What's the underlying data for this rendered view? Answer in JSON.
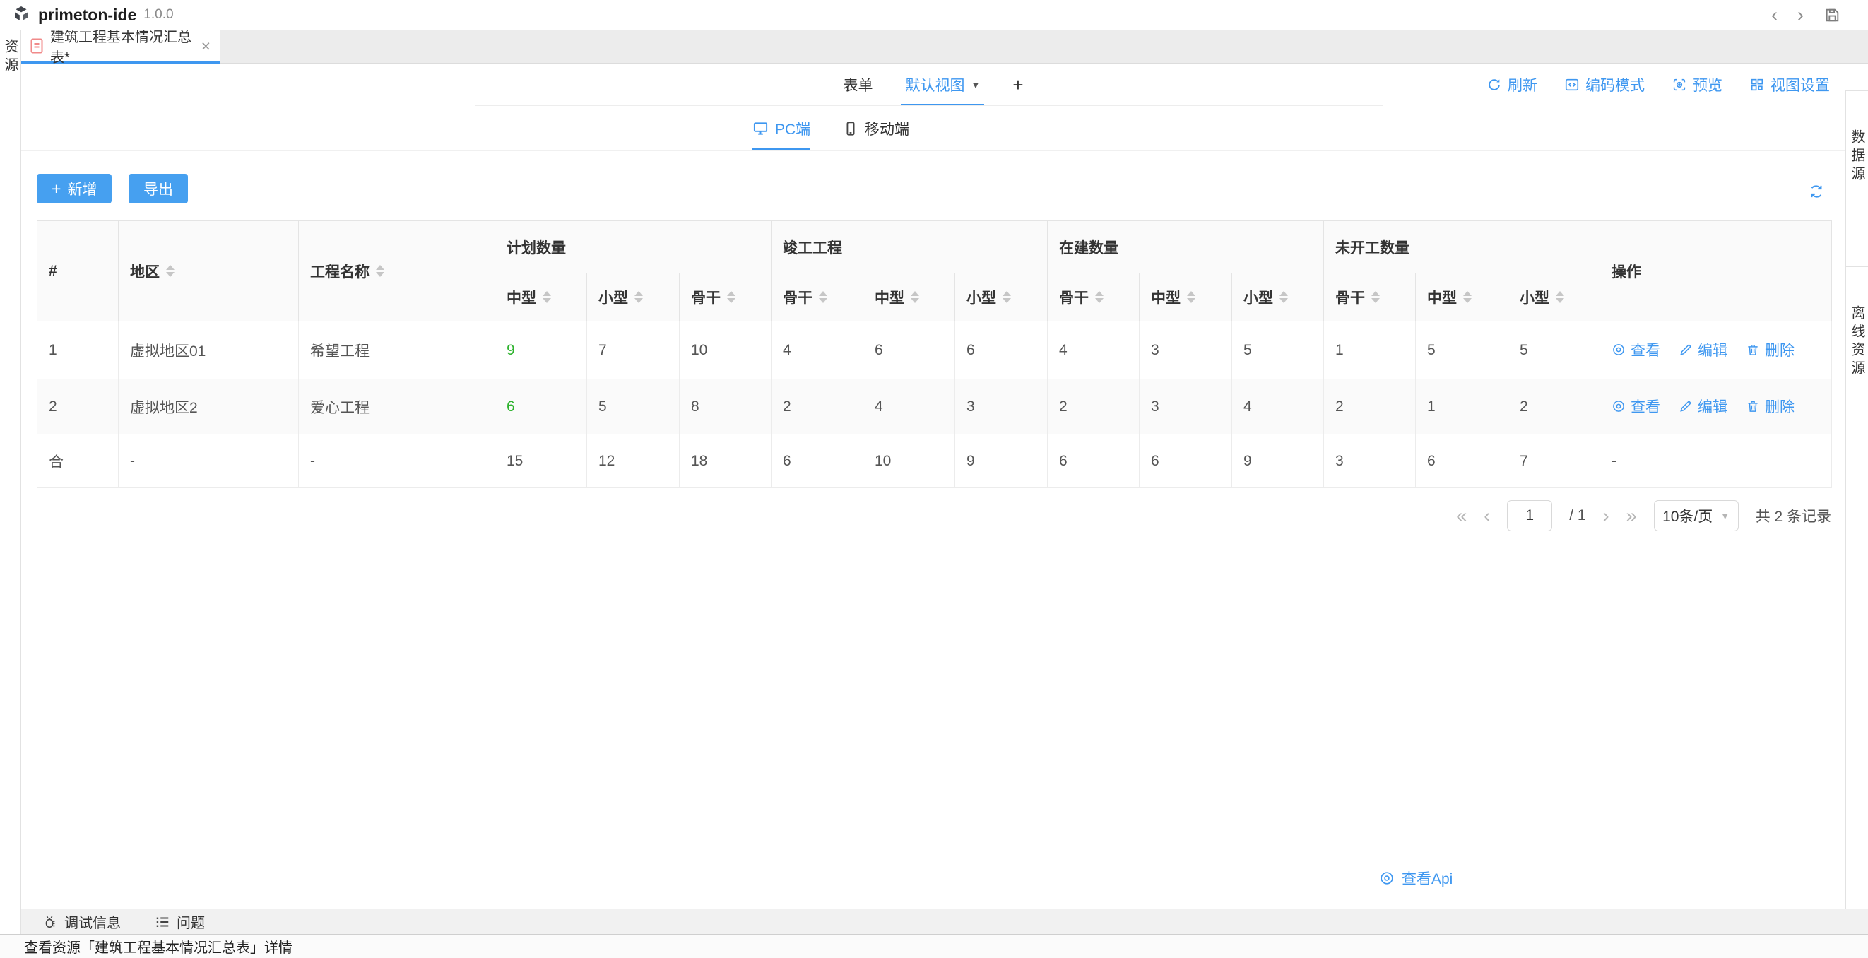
{
  "app": {
    "name": "primeton-ide",
    "version": "1.0.0"
  },
  "titlebar": {
    "nav_back": "‹",
    "nav_forward": "›"
  },
  "left_sidebar": {
    "label": "资源"
  },
  "right_sidebar": {
    "top": "数据源",
    "bottom": "离线资源"
  },
  "editor_tab": {
    "title": "建筑工程基本情况汇总表*",
    "close": "×"
  },
  "view_tabs": {
    "form": "表单",
    "active": "默认视图",
    "caret": "▼",
    "add": "+"
  },
  "toolbar": {
    "refresh": "刷新",
    "code_mode": "编码模式",
    "preview": "预览",
    "view_settings": "视图设置"
  },
  "device_tabs": {
    "pc": "PC端",
    "mobile": "移动端"
  },
  "actions": {
    "add_plus": "+",
    "add_label": "新增",
    "export_label": "导出"
  },
  "table": {
    "corner_columns": [
      {
        "label": "#",
        "sortable": false
      },
      {
        "label": "地区",
        "sortable": true
      },
      {
        "label": "工程名称",
        "sortable": true
      }
    ],
    "groups": [
      {
        "label": "计划数量",
        "columns": [
          {
            "label": "中型"
          },
          {
            "label": "小型"
          },
          {
            "label": "骨干"
          }
        ]
      },
      {
        "label": "竣工工程",
        "columns": [
          {
            "label": "骨干"
          },
          {
            "label": "中型"
          },
          {
            "label": "小型"
          }
        ]
      },
      {
        "label": "在建数量",
        "columns": [
          {
            "label": "骨干"
          },
          {
            "label": "中型"
          },
          {
            "label": "小型"
          }
        ]
      },
      {
        "label": "未开工数量",
        "columns": [
          {
            "label": "骨干"
          },
          {
            "label": "中型"
          },
          {
            "label": "小型"
          }
        ]
      }
    ],
    "actions_column": "操作",
    "rows": [
      {
        "index": "1",
        "region": "虚拟地区01",
        "project": "希望工程",
        "values": [
          "9",
          "7",
          "10",
          "4",
          "6",
          "6",
          "4",
          "3",
          "5",
          "1",
          "5",
          "5"
        ]
      },
      {
        "index": "2",
        "region": "虚拟地区2",
        "project": "爱心工程",
        "values": [
          "6",
          "5",
          "8",
          "2",
          "4",
          "3",
          "2",
          "3",
          "4",
          "2",
          "1",
          "2"
        ]
      }
    ],
    "row_actions": [
      {
        "label": "查看",
        "icon": "eye-icon"
      },
      {
        "label": "编辑",
        "icon": "edit-icon"
      },
      {
        "label": "删除",
        "icon": "delete-icon"
      }
    ],
    "summary_row": {
      "index": "合",
      "region": "-",
      "project": "-",
      "values": [
        "15",
        "12",
        "18",
        "6",
        "10",
        "9",
        "6",
        "6",
        "9",
        "3",
        "6",
        "7"
      ],
      "actions": "-"
    }
  },
  "pagination": {
    "first": "«",
    "prev": "‹",
    "page": "1",
    "of": "/ 1",
    "next": "›",
    "last": "»",
    "page_size": "10条/页",
    "caret": "▼",
    "total": "共 2 条记录"
  },
  "api_link": {
    "label": "查看Api"
  },
  "bottom_bar": {
    "debug": "调试信息",
    "problems": "问题"
  },
  "status_bar": {
    "text": "查看资源「建筑工程基本情况汇总表」详情"
  },
  "colors": {
    "accent": "#3e97f0",
    "button_blue": "#46a0f0",
    "green": "#2fb32f",
    "header_bg": "#fafafa"
  }
}
